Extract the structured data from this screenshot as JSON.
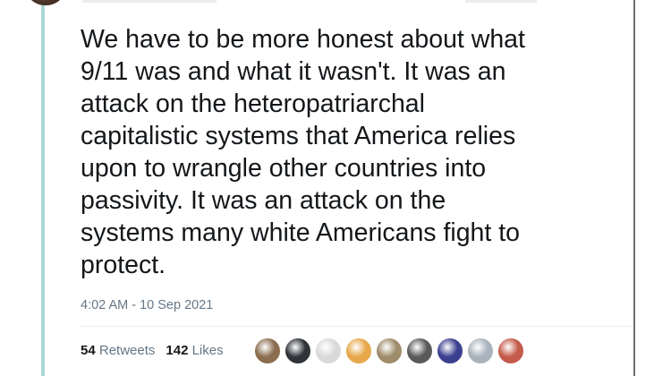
{
  "tweet": {
    "text_lines": [
      "We have to be more honest about what",
      "9/11 was and what it wasn't. It was an",
      "attack on the heteropatriarchal",
      "capitalistic systems that America relies",
      "upon to wrangle other countries into",
      "passivity. It was an attack on the",
      "systems many white Americans fight to",
      "protect."
    ],
    "timestamp": "4:02 AM - 10 Sep 2021"
  },
  "stats": {
    "retweets_count": "54",
    "retweets_label": "Retweets",
    "likes_count": "142",
    "likes_label": "Likes"
  },
  "likers": [
    {
      "color": "#8b6d4f"
    },
    {
      "color": "#2f3338"
    },
    {
      "color": "#d9d9d9"
    },
    {
      "color": "#e6a84b"
    },
    {
      "color": "#9e8c6a"
    },
    {
      "color": "#5a5a5a"
    },
    {
      "color": "#3b3f8f"
    },
    {
      "color": "#a8b3bd"
    },
    {
      "color": "#c45a4a"
    }
  ],
  "colors": {
    "thread_line": "#a9d8d6",
    "meta_gray": "#657786",
    "text": "#14171a"
  }
}
